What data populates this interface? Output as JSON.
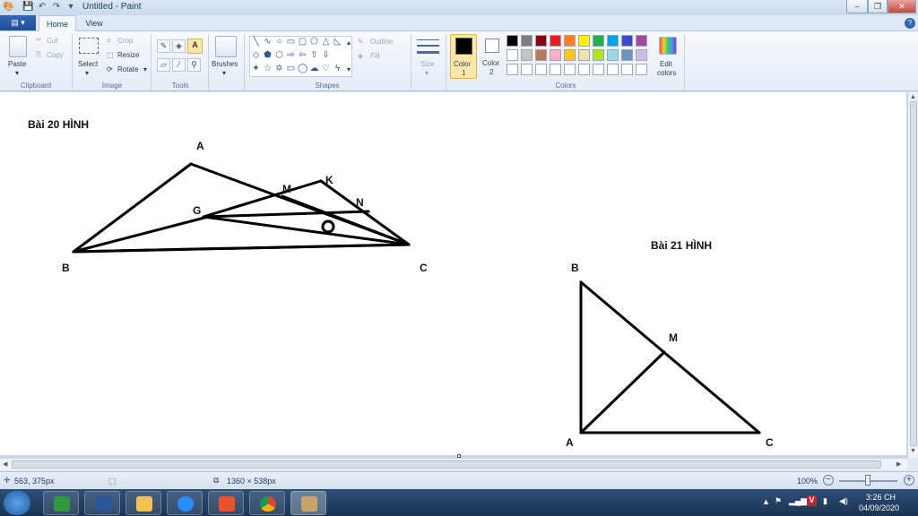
{
  "window": {
    "title": "Untitled - Paint",
    "controls": [
      "–",
      "❐",
      "✕"
    ]
  },
  "tabs": {
    "file": "▤ ▾",
    "home": "Home",
    "view": "View"
  },
  "ribbon": {
    "clipboard": {
      "paste": "Paste",
      "cut": "Cut",
      "copy": "Copy",
      "label": "Clipboard"
    },
    "image": {
      "select": "Select",
      "crop": "Crop",
      "resize": "Resize",
      "rotate": "Rotate",
      "label": "Image"
    },
    "tools": {
      "label": "Tools",
      "text_tool": "A"
    },
    "brushes": {
      "label": "Brushes"
    },
    "shapes": {
      "outline": "Outline",
      "fill": "Fill",
      "label": "Shapes"
    },
    "size": {
      "label": "Size"
    },
    "color1": {
      "label": "Color",
      "num": "1",
      "value": "#000000"
    },
    "color2": {
      "label": "Color",
      "num": "2",
      "value": "#ffffff"
    },
    "colors": {
      "label": "Colors",
      "edit_label": "Edit",
      "edit_label2": "colors",
      "row1": [
        "#000000",
        "#7f7f7f",
        "#880015",
        "#ed1c24",
        "#ff7f27",
        "#fff200",
        "#22b14c",
        "#00a2e8",
        "#3f48cc",
        "#a349a4"
      ],
      "row2": [
        "#ffffff",
        "#c3c3c3",
        "#b97a57",
        "#ffaec9",
        "#ffc90e",
        "#efe4b0",
        "#b5e61d",
        "#99d9ea",
        "#7092be",
        "#c8bfe7"
      ],
      "row3": [
        "#ffffff",
        "#ffffff",
        "#ffffff",
        "#ffffff",
        "#ffffff",
        "#ffffff",
        "#ffffff",
        "#ffffff",
        "#ffffff",
        "#ffffff"
      ]
    }
  },
  "drawing": {
    "title20": "Bài 20 HÌNH",
    "title21": "Bài 21 HÌNH",
    "fig20_labels": {
      "A": "A",
      "B": "B",
      "C": "C",
      "M": "M",
      "K": "K",
      "N": "N",
      "G": "G",
      "O": "O"
    },
    "fig21_labels": {
      "B": "B",
      "M": "M",
      "A": "A",
      "C": "C"
    }
  },
  "status": {
    "cursor": "563, 375px",
    "size": "1360 × 538px",
    "zoom": "100%"
  },
  "taskbar": {
    "time": "3:26 CH",
    "date": "04/09/2020"
  }
}
